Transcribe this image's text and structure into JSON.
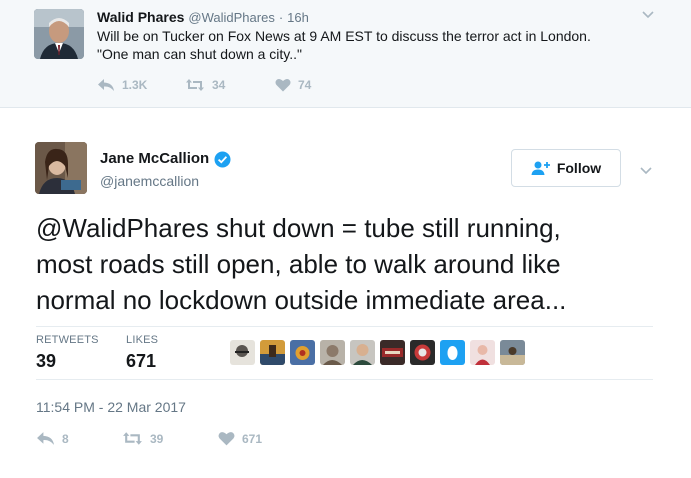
{
  "parent_tweet": {
    "author_name": "Walid Phares",
    "author_handle": "@WalidPhares",
    "time": "16h",
    "text_lines": [
      "Will be on Tucker on Fox News at 9 AM EST to discuss the terror act in London.",
      "\"One man can shut down a city..\""
    ],
    "reply_count": "1.3K",
    "retweet_count": "34",
    "like_count": "74"
  },
  "main_tweet": {
    "author_name": "Jane McCallion",
    "author_handle": "@janemccallion",
    "verified": true,
    "follow_label": "Follow",
    "text_lines": [
      "@WalidPhares shut down = tube still running,",
      "most roads still open, able to walk around like",
      "normal no lockdown outside immediate area..."
    ],
    "retweets_label": "RETWEETS",
    "retweets_value": "39",
    "likes_label": "LIKES",
    "likes_value": "671",
    "timestamp": "11:54 PM - 22 Mar 2017",
    "reply_count": "8",
    "retweet_count": "39",
    "like_count": "671"
  },
  "colors": {
    "verified": "#1da1f2",
    "action_gray": "#aab8c2",
    "secondary_text": "#657786",
    "follow_icon": "#1da1f2"
  },
  "icons": {
    "reply": "reply-icon",
    "retweet": "retweet-icon",
    "like": "heart-icon",
    "verified": "verified-badge-icon",
    "follow": "follow-person-plus-icon",
    "menu": "chevron-down-icon"
  }
}
